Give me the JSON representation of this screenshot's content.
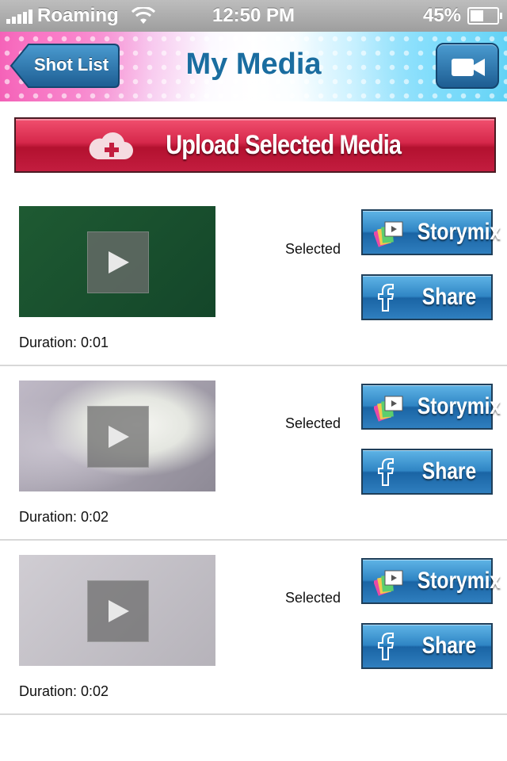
{
  "status_bar": {
    "carrier": "Roaming",
    "time": "12:50 PM",
    "battery": "45%",
    "battery_level": 0.45
  },
  "nav": {
    "back_label": "Shot List",
    "title": "My Media"
  },
  "upload": {
    "label": "Upload Selected Media"
  },
  "media": [
    {
      "selected_text": "Selected",
      "storymix_label": "Storymix",
      "share_label": "Share",
      "duration": "Duration: 0:01"
    },
    {
      "selected_text": "Selected",
      "storymix_label": "Storymix",
      "share_label": "Share",
      "duration": "Duration: 0:02"
    },
    {
      "selected_text": "Selected",
      "storymix_label": "Storymix",
      "share_label": "Share",
      "duration": "Duration: 0:02"
    }
  ],
  "icons": {
    "signal": "signal-icon",
    "wifi": "wifi-icon",
    "battery": "battery-icon",
    "camera": "video-camera-icon",
    "upload": "cloud-plus-icon",
    "play": "play-icon",
    "storymix": "storymix-icon",
    "share": "facebook-icon"
  },
  "colors": {
    "title": "#1a6da0",
    "upload_red": "#c31d3f",
    "button_blue": "#2f85c4"
  }
}
